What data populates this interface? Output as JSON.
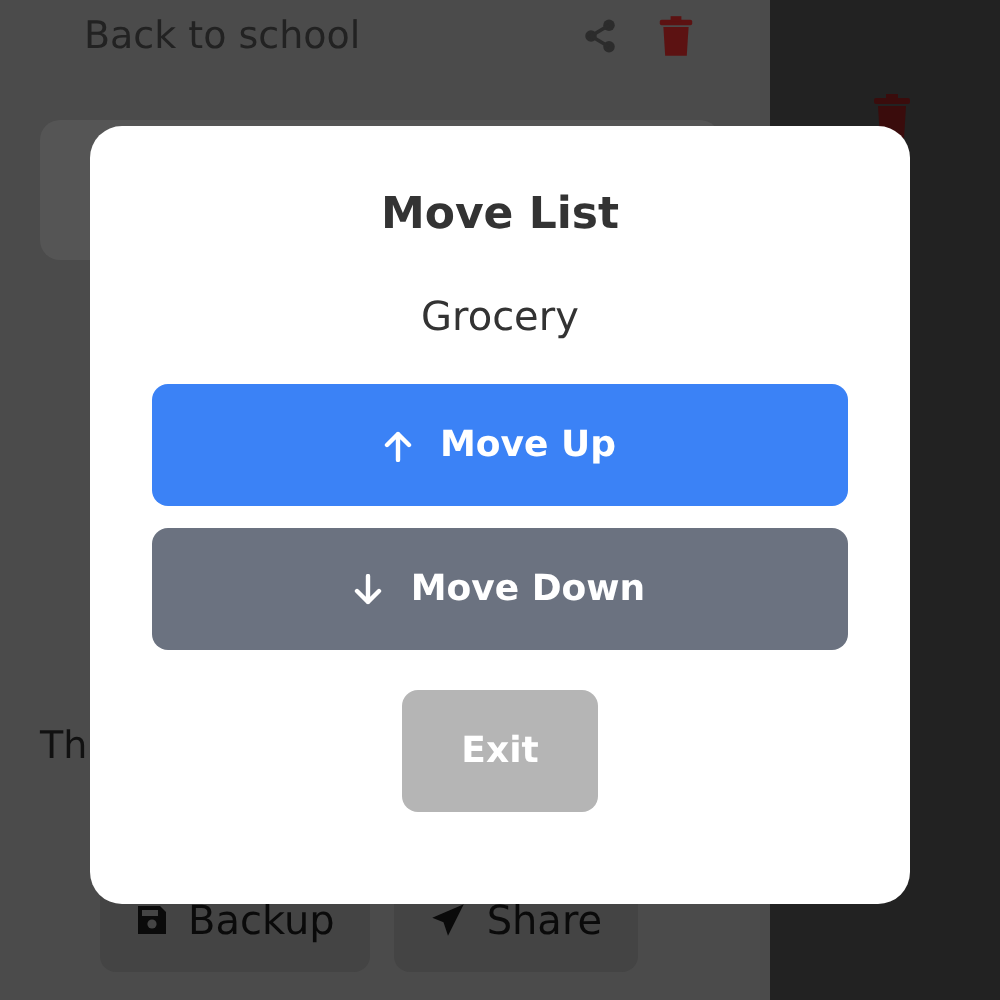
{
  "background": {
    "lists": [
      {
        "name": "Back to school"
      }
    ],
    "note": "Th",
    "buttons": [
      {
        "label": "Backup",
        "kind": "backup"
      },
      {
        "label": "Share",
        "kind": "share"
      }
    ]
  },
  "dialog": {
    "title": "Move List",
    "subtitle": "Grocery",
    "actions": [
      {
        "label": "Move Up",
        "kind": "up",
        "disabled": false
      },
      {
        "label": "Move Down",
        "kind": "down",
        "disabled": false
      },
      {
        "label": "Exit",
        "kind": "exit",
        "disabled": true
      }
    ]
  }
}
